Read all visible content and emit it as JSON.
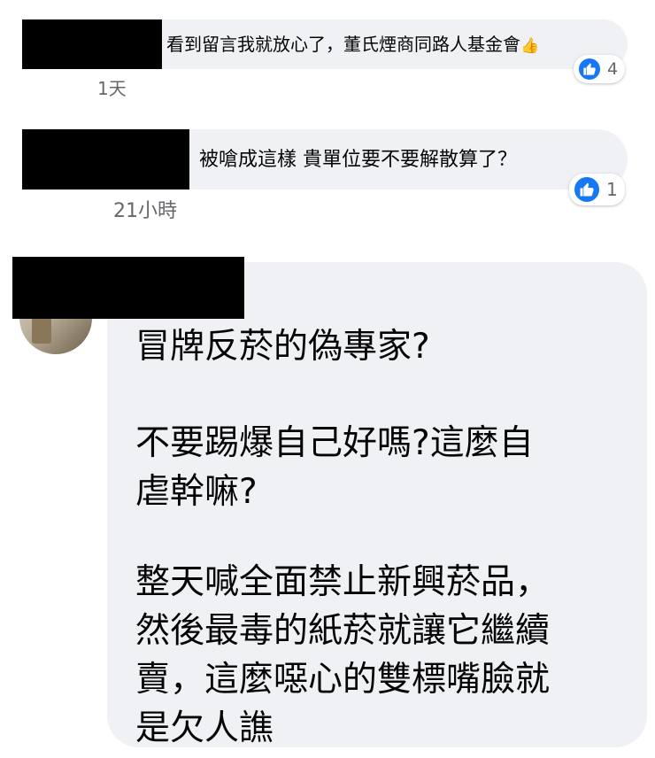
{
  "comments": [
    {
      "text": "看到留言我就放心了，董氏煙商同路人基金會",
      "emoji": "👍",
      "time": "1天",
      "reaction_count": "4"
    },
    {
      "text": "被嗆成這樣 貴單位要不要解散算了？",
      "time": "21小時",
      "reaction_count": "1"
    },
    {
      "paragraphs": [
        "冒牌反菸的偽專家?",
        "不要踢爆自己好嗎?這麼自\n虐幹嘛?",
        "整天喊全面禁止新興菸品，\n然後最毒的紙菸就讓它繼續\n賣，這麼噁心的雙標嘴臉就\n是欠人譙"
      ]
    }
  ],
  "colors": {
    "bubble": "#eff1f4",
    "like_blue": "#1877f2",
    "meta_gray": "#65676b",
    "redaction": "#000000"
  },
  "icons": {
    "reaction": "like-icon"
  }
}
